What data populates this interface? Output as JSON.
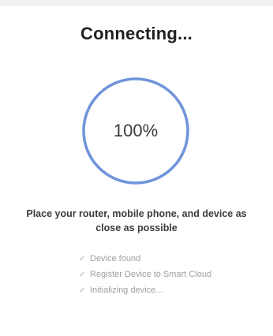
{
  "title": "Connecting...",
  "progress": {
    "value": 1.0,
    "label": "100%",
    "ring_color": "#6f94da"
  },
  "instruction": "Place your router, mobile phone, and device as close as possible",
  "checklist": [
    {
      "icon": "check-icon",
      "label": "Device found"
    },
    {
      "icon": "check-icon",
      "label": "Register Device to Smart Cloud"
    },
    {
      "icon": "check-icon",
      "label": "Initializing device..."
    }
  ]
}
